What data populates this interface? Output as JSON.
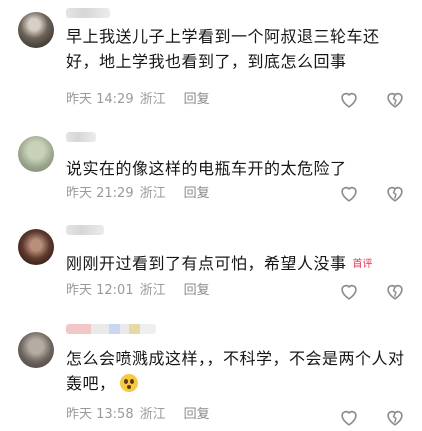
{
  "comments": [
    {
      "text": "早上我送儿子上学看到一个阿叔退三轮车还好，地上学我也看到了，到底怎么回事",
      "time": "昨天 14:29",
      "location": "浙江",
      "reply_label": "回复",
      "tag": ""
    },
    {
      "text": "说实在的像这样的电瓶车开的太危险了",
      "time": "昨天 21:29",
      "location": "浙江",
      "reply_label": "回复",
      "tag": ""
    },
    {
      "text": "刚刚开过看到了有点可怕，希望人没事",
      "time": "昨天 12:01",
      "location": "浙江",
      "reply_label": "回复",
      "tag": "首评"
    },
    {
      "text": "怎么会喷溅成这样，，不科学，不会是两个人对轰吧，",
      "time": "昨天 13:58",
      "location": "浙江",
      "reply_label": "回复",
      "tag": ""
    }
  ],
  "icons": {
    "like": "heart-outline-icon",
    "dislike": "broken-heart-outline-icon",
    "emoji": "flushed-face-emoji"
  },
  "colors": {
    "tag": "#e8344e",
    "meta": "#9a9a9a",
    "icon": "#8c8c8c"
  }
}
